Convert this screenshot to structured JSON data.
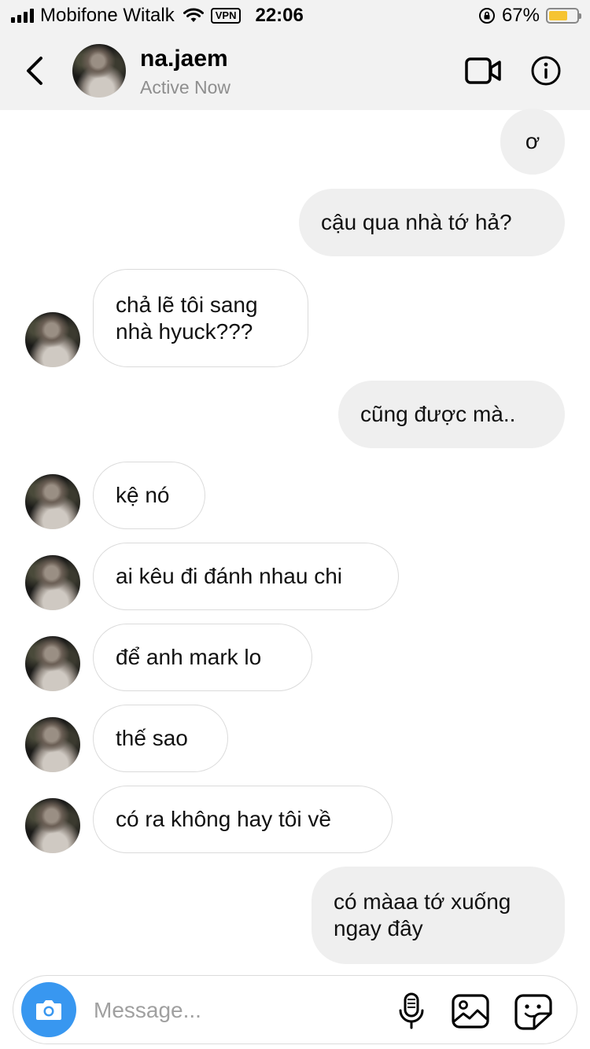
{
  "status_bar": {
    "carrier": "Mobifone Witalk",
    "vpn": "VPN",
    "time": "22:06",
    "battery": "67%",
    "battery_level": 0.67,
    "battery_color": "#f6c433",
    "icons": [
      "signal-icon",
      "wifi-icon",
      "rotation-lock-icon",
      "battery-icon"
    ]
  },
  "header": {
    "name": "na.jaem",
    "status": "Active Now",
    "icons": [
      "back-arrow-icon",
      "video-call-icon",
      "info-icon"
    ]
  },
  "messages": [
    {
      "side": "sent",
      "text": "ơ"
    },
    {
      "side": "sent",
      "text": "cậu qua nhà tớ hả?"
    },
    {
      "side": "received",
      "text": "chả lẽ tôi sang\nnhà hyuck???"
    },
    {
      "side": "sent",
      "text": "cũng được mà.."
    },
    {
      "side": "received",
      "text": "kệ nó"
    },
    {
      "side": "received",
      "text": "ai kêu đi đánh nhau chi"
    },
    {
      "side": "received",
      "text": "để anh mark lo"
    },
    {
      "side": "received",
      "text": "thế sao"
    },
    {
      "side": "received",
      "text": "có ra không hay tôi về"
    },
    {
      "side": "sent",
      "text": "có màaa tớ xuống\nngay đây"
    }
  ],
  "composer": {
    "placeholder": "Message...",
    "value": "",
    "icons": [
      "camera-icon",
      "microphone-icon",
      "gallery-icon",
      "sticker-icon"
    ]
  },
  "colors": {
    "accent": "#3897f0",
    "sent_bubble": "#efefef",
    "header_bg": "#f2f2f2",
    "secondary_text": "#8e8e8e"
  }
}
